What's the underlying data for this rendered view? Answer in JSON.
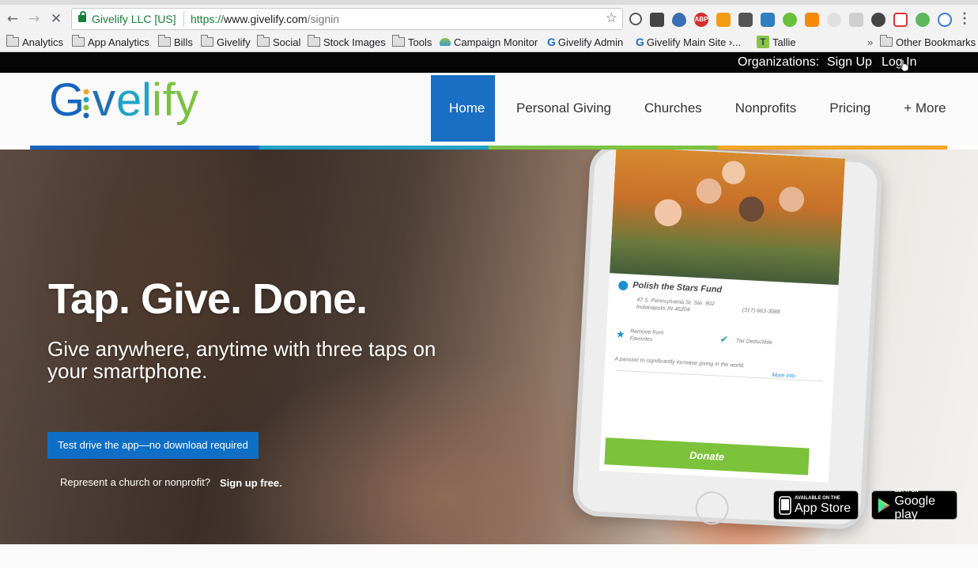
{
  "browser": {
    "site_identity": "Givelify LLC [US]",
    "url_protocol": "https://",
    "url_host": "www.givelify.com",
    "url_path": "/signin",
    "back_icon": "arrow-left-icon",
    "forward_icon": "arrow-right-icon",
    "stop_icon": "close-icon",
    "extension_badge": "ABP",
    "bookmarks": [
      {
        "label": "Analytics",
        "icon": "folder-icon"
      },
      {
        "label": "App Analytics",
        "icon": "folder-icon"
      },
      {
        "label": "Bills",
        "icon": "folder-icon"
      },
      {
        "label": "Givelify",
        "icon": "folder-icon"
      },
      {
        "label": "Social",
        "icon": "folder-icon"
      },
      {
        "label": "Stock Images",
        "icon": "folder-icon"
      },
      {
        "label": "Tools",
        "icon": "folder-icon"
      },
      {
        "label": "Campaign Monitor",
        "icon": "campaign-monitor-icon"
      },
      {
        "label": "Givelify Admin",
        "icon": "givelify-g-icon"
      },
      {
        "label": "Givelify Main Site ›...",
        "icon": "givelify-g-icon"
      },
      {
        "label": "Tallie",
        "icon": "tallie-icon"
      }
    ],
    "overflow_chevron": "»",
    "other_bookmarks": "Other Bookmarks"
  },
  "org_bar": {
    "label": "Organizations:",
    "sign_up": "Sign Up",
    "log_in": "Log In"
  },
  "header": {
    "logo_text": "Givelify",
    "nav": [
      "Home",
      "Personal Giving",
      "Churches",
      "Nonprofits",
      "Pricing",
      "+ More"
    ],
    "active_nav": "Home",
    "accent_colors": [
      "#1565c0",
      "#1fa3c7",
      "#7cc242",
      "#f5a623"
    ]
  },
  "hero": {
    "headline": "Tap. Give. Done.",
    "subhead": "Give anywhere, anytime with three taps on your smartphone.",
    "cta_button": "Test drive the app—no download required",
    "represent_text": "Represent a church or nonprofit?",
    "signup_link": "Sign up free."
  },
  "phone_screen": {
    "fund_name": "Polish the Stars Fund",
    "address": "47 S. Pennsylvania St. Ste. 902 Indianapolis IN 46204",
    "phone": "(317) 663-3088",
    "remove_favorites": "Remove from Favorites",
    "tax_deductible": "Tax Deductible",
    "mission": "A passion to significantly increase giving in the world.",
    "more_info": "More Info",
    "donate": "Donate"
  },
  "badges": {
    "app_store_small": "AVAILABLE ON THE",
    "app_store_big": "App Store",
    "google_small": "GET IT ON",
    "google_big": "Google play"
  },
  "colors": {
    "primary_blue": "#1a6fc4",
    "donate_green": "#7cc23b",
    "top_bar": "#050505"
  }
}
